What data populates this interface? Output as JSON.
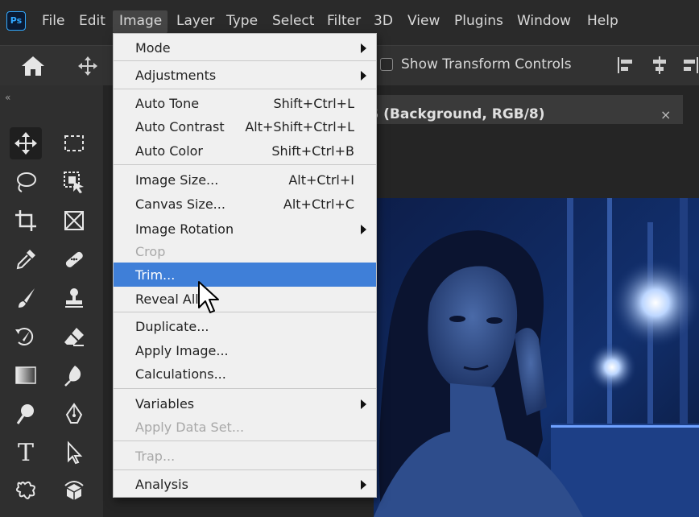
{
  "menubar": {
    "logo": "Ps",
    "items": [
      "File",
      "Edit",
      "Image",
      "Layer",
      "Type",
      "Select",
      "Filter",
      "3D",
      "View",
      "Plugins",
      "Window",
      "Help"
    ],
    "active": "Image"
  },
  "options_bar": {
    "show_transform_label": "Show Transform Controls",
    "show_transform_checked": false
  },
  "toolbox": {
    "collapse_glyph": "«",
    "tools": [
      "move-tool-icon",
      "rectangular-marquee-icon",
      "lasso-icon",
      "object-selection-icon",
      "crop-icon",
      "frame-icon",
      "eyedropper-icon",
      "healing-brush-icon",
      "brush-icon",
      "clone-stamp-icon",
      "history-brush-icon",
      "eraser-icon",
      "gradient-icon",
      "blur-icon",
      "dodge-icon",
      "pen-icon",
      "type-icon",
      "path-selection-icon",
      "custom-shape-icon",
      "3d-rotate-icon"
    ],
    "type_tool_glyph": "T"
  },
  "document": {
    "tab_title": "Ś (Background, RGB/8)",
    "tab_close": "×"
  },
  "image_menu": {
    "items": [
      {
        "label": "Mode",
        "shortcut": "",
        "submenu": true,
        "disabled": false
      },
      {
        "label": "Adjustments",
        "shortcut": "",
        "submenu": true,
        "disabled": false
      },
      {
        "label": "Auto Tone",
        "shortcut": "Shift+Ctrl+L",
        "submenu": false,
        "disabled": false
      },
      {
        "label": "Auto Contrast",
        "shortcut": "Alt+Shift+Ctrl+L",
        "submenu": false,
        "disabled": false
      },
      {
        "label": "Auto Color",
        "shortcut": "Shift+Ctrl+B",
        "submenu": false,
        "disabled": false
      },
      {
        "label": "Image Size...",
        "shortcut": "Alt+Ctrl+I",
        "submenu": false,
        "disabled": false
      },
      {
        "label": "Canvas Size...",
        "shortcut": "Alt+Ctrl+C",
        "submenu": false,
        "disabled": false
      },
      {
        "label": "Image Rotation",
        "shortcut": "",
        "submenu": true,
        "disabled": false
      },
      {
        "label": "Crop",
        "shortcut": "",
        "submenu": false,
        "disabled": true
      },
      {
        "label": "Trim...",
        "shortcut": "",
        "submenu": false,
        "disabled": false,
        "highlighted": true
      },
      {
        "label": "Reveal All",
        "shortcut": "",
        "submenu": false,
        "disabled": false
      },
      {
        "label": "Duplicate...",
        "shortcut": "",
        "submenu": false,
        "disabled": false
      },
      {
        "label": "Apply Image...",
        "shortcut": "",
        "submenu": false,
        "disabled": false
      },
      {
        "label": "Calculations...",
        "shortcut": "",
        "submenu": false,
        "disabled": false
      },
      {
        "label": "Variables",
        "shortcut": "",
        "submenu": true,
        "disabled": false
      },
      {
        "label": "Apply Data Set...",
        "shortcut": "",
        "submenu": false,
        "disabled": true
      },
      {
        "label": "Trap...",
        "shortcut": "",
        "submenu": false,
        "disabled": true
      },
      {
        "label": "Analysis",
        "shortcut": "",
        "submenu": true,
        "disabled": false
      }
    ]
  },
  "colors": {
    "menu_highlight": "#3f7fd8",
    "ps_blue": "#31a8ff",
    "photo_tint": "#1b3a7a"
  }
}
